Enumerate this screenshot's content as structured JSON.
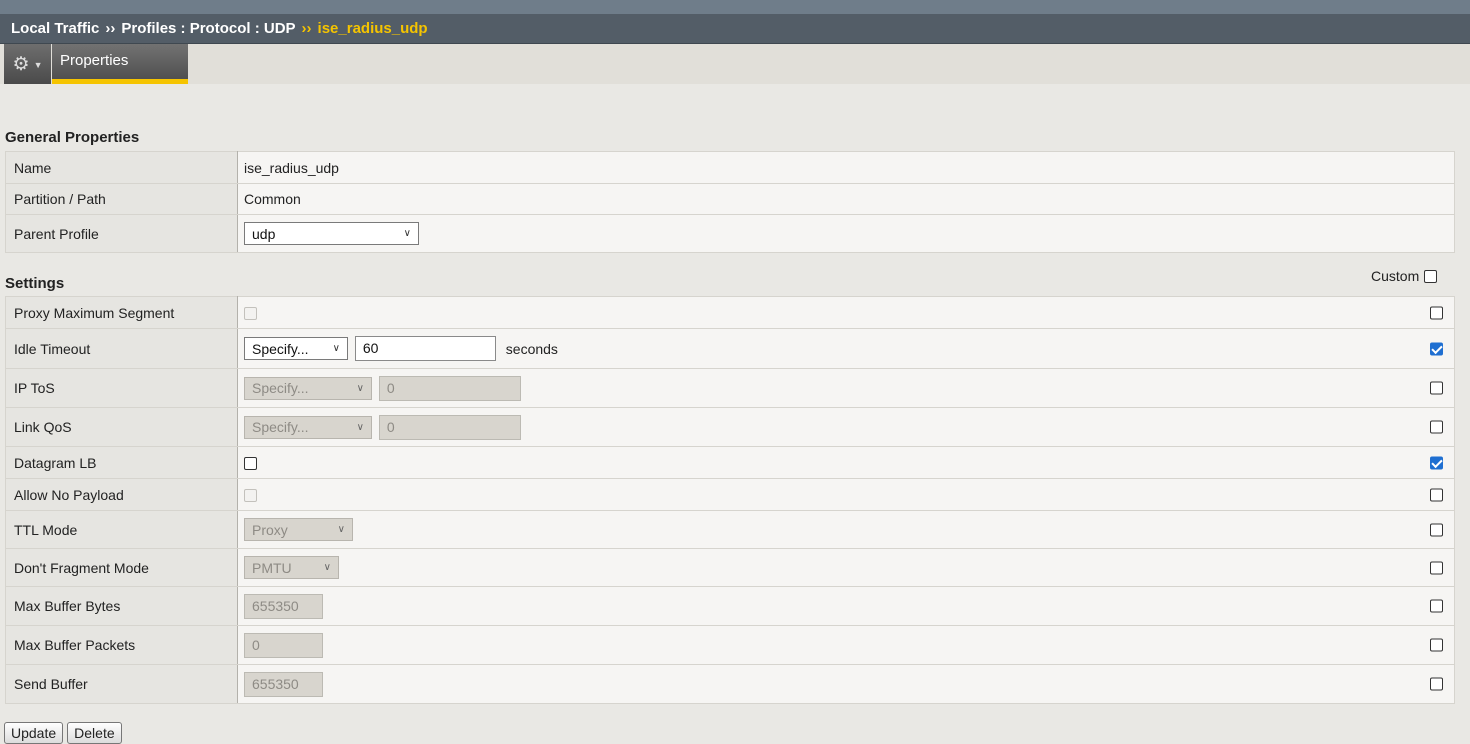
{
  "breadcrumb": {
    "item1": "Local Traffic",
    "item2": "Profiles : Protocol : UDP",
    "current": "ise_radius_udp",
    "separator": "››"
  },
  "tabs": {
    "properties": "Properties"
  },
  "general": {
    "title": "General Properties",
    "rows": {
      "name": {
        "label": "Name",
        "value": "ise_radius_udp"
      },
      "partition": {
        "label": "Partition / Path",
        "value": "Common"
      },
      "parent": {
        "label": "Parent Profile",
        "value": "udp"
      }
    }
  },
  "settings": {
    "title": "Settings",
    "custom_label": "Custom",
    "rows": {
      "proxy_mss": {
        "label": "Proxy Maximum Segment",
        "checked": false,
        "custom_checked": false
      },
      "idle_timeout": {
        "label": "Idle Timeout",
        "select": "Specify...",
        "value": "60",
        "unit": "seconds",
        "custom_checked": true
      },
      "ip_tos": {
        "label": "IP ToS",
        "select": "Specify...",
        "value": "0",
        "custom_checked": false
      },
      "link_qos": {
        "label": "Link QoS",
        "select": "Specify...",
        "value": "0",
        "custom_checked": false
      },
      "datagram_lb": {
        "label": "Datagram LB",
        "checked": false,
        "custom_checked": true
      },
      "allow_no_payload": {
        "label": "Allow No Payload",
        "checked": false,
        "custom_checked": false
      },
      "ttl_mode": {
        "label": "TTL Mode",
        "select": "Proxy",
        "custom_checked": false
      },
      "dont_fragment": {
        "label": "Don't Fragment Mode",
        "select": "PMTU",
        "custom_checked": false
      },
      "max_buffer_bytes": {
        "label": "Max Buffer Bytes",
        "value": "655350",
        "custom_checked": false
      },
      "max_buffer_packets": {
        "label": "Max Buffer Packets",
        "value": "0",
        "custom_checked": false
      },
      "send_buffer": {
        "label": "Send Buffer",
        "value": "655350",
        "custom_checked": false
      }
    }
  },
  "buttons": {
    "update": "Update",
    "delete": "Delete"
  },
  "colors": {
    "accent": "#f5c400",
    "breadcrumb_bg": "#535d67",
    "checkbox_checked": "#1f6fd1"
  },
  "icons": {
    "gear": "gear-icon",
    "dropdown": "chevron-down-icon"
  }
}
